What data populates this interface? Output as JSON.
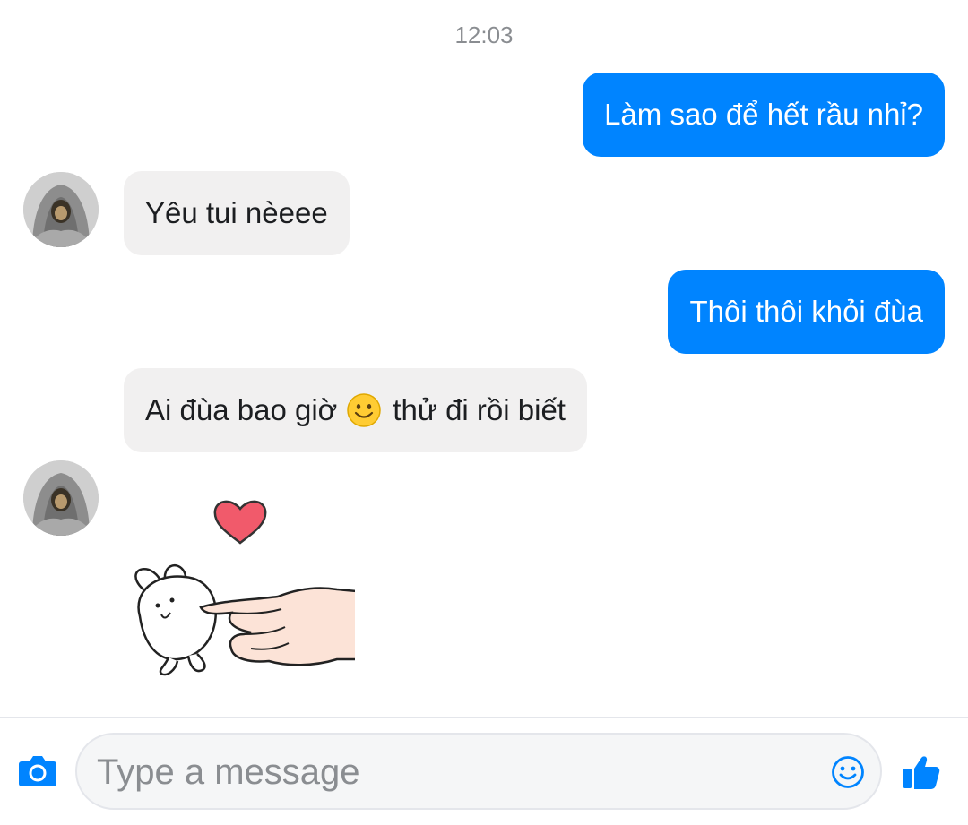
{
  "timestamp": "12:03",
  "messages": [
    {
      "direction": "outgoing",
      "text": "Làm sao để hết rầu nhỉ?"
    },
    {
      "direction": "incoming",
      "text": "Yêu tui nèeee"
    },
    {
      "direction": "outgoing",
      "text": "Thôi thôi khỏi đùa"
    },
    {
      "direction": "incoming",
      "text_before_emoji": "Ai đùa bao giờ",
      "emoji": "smiling-face-emoji",
      "text_after_emoji": "thử đi rồi biết"
    },
    {
      "direction": "incoming",
      "type": "sticker",
      "sticker": "bunny-poked-by-finger-with-heart"
    }
  ],
  "composer": {
    "placeholder": "Type a message",
    "value": "",
    "icons": {
      "left": "camera-icon",
      "inside_right": "smiley-icon",
      "right": "thumbs-up-icon"
    }
  },
  "colors": {
    "outgoing_bubble": "#0084ff",
    "incoming_bubble": "#f1f0f0",
    "accent": "#0084ff",
    "timestamp_text": "#8a8d91"
  }
}
